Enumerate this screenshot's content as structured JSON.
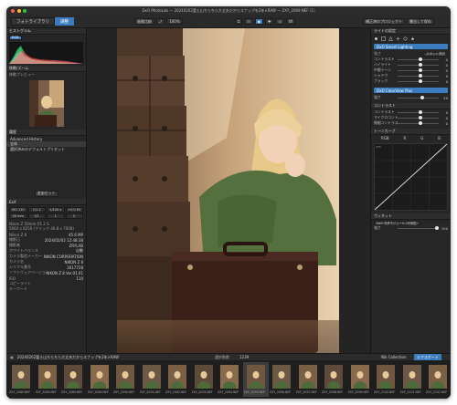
{
  "window": {
    "title": "DxO PhotoLab — 20240202富士山ちらちら大丈夫だからスナップを2年×RAW — ZXY_2089.NEF (1)"
  },
  "toolbar": {
    "tabs": [
      {
        "label": "フォトライブラリ",
        "active": false
      },
      {
        "label": "調整",
        "active": true
      }
    ],
    "compare_label": "画像比較",
    "zoom_label": "100%",
    "export_label": "書出して保存",
    "apply_label": "補正済のプロジェクト"
  },
  "left_panel": {
    "histogram_title": "ヒストグラム",
    "histogram_tab": "RGB",
    "navigator_title": "移動/ズーム",
    "preview_title": "移動プレビュー",
    "history_title": "履歴",
    "history_items": [
      "Advanced History",
      "全体",
      "選択済みのデフォルトプリセット"
    ],
    "history_button": "追加セット",
    "exif_title": "Exif",
    "exif_cells": [
      "ISO 110",
      "1/1.2",
      "1/100 s",
      "+0.0 EV",
      "50 mm",
      "f/1",
      "1",
      "0",
      "",
      ""
    ],
    "meta_camera": "Nikon Z 50mm f/1.2 S",
    "meta_size": "5664 x 8256 (フリック 46.8 x 7008)",
    "meta_rows": [
      {
        "k": "Nikon Z 8",
        "v": "45.6 MP"
      },
      {
        "k": "撮影日",
        "v": "2024/02/02 12:48:38"
      },
      {
        "k": "撮影者",
        "v": "ZRYLAB"
      },
      {
        "k": "ホワイトバランス",
        "v": "自動"
      },
      {
        "k": "カメラ製造メーカー",
        "v": "NIKON CORPORATION"
      },
      {
        "k": "カメラ名",
        "v": "NIKON Z 8"
      },
      {
        "k": "シリアル番号",
        "v": "3017728"
      },
      {
        "k": "ソフトウェアバージョン",
        "v": "NIKON Z 8 Ver.01.01"
      },
      {
        "k": "ISO",
        "v": "110"
      },
      {
        "k": "コピーライト",
        "v": ""
      },
      {
        "k": "キーワード",
        "v": ""
      }
    ]
  },
  "right_panel": {
    "title": "ライトの設定",
    "lighting_button": "DxO Smart Lighting",
    "mode_label": "スポット測光",
    "intensity_label": "強さ",
    "sliders": [
      {
        "label": "コントラスト",
        "value": "0",
        "pos": 0.5
      },
      {
        "label": "ハイライト",
        "value": "0",
        "pos": 0.5
      },
      {
        "label": "中間トーン",
        "value": "0",
        "pos": 0.5
      },
      {
        "label": "シャドウ",
        "value": "0",
        "pos": 0.5
      },
      {
        "label": "ブラック",
        "value": "0",
        "pos": 0.5
      }
    ],
    "clearview_button": "DxO ClearView Plus",
    "clearview_slider": {
      "label": "強さ",
      "value": "50",
      "pos": 0.55
    },
    "contrast_title": "コントラスト",
    "contrast_sliders": [
      {
        "label": "コントラスト",
        "value": "0",
        "pos": 0.5
      },
      {
        "label": "マイクロコントラスト",
        "value": "0",
        "pos": 0.5
      },
      {
        "label": "微細コントラスト",
        "value": "0",
        "pos": 0.5
      }
    ],
    "tonecurve_title": "トーンカーブ",
    "tonecurve_tabs": [
      "RGB",
      "R",
      "G",
      "B"
    ],
    "tonecurve_axis": [
      "255",
      "0"
    ],
    "vignette_title": "ヴィネット",
    "vignette_mode": "DxO 光学モジュール (可用性)",
    "vignette_value": "100"
  },
  "filmstrip": {
    "path": "20240202富士山ちらちら大丈夫だからスナップを2年×RAW",
    "count_label": "選択数数",
    "count_value": "1239",
    "filmstrip_mode": "Nik Collection",
    "export_label": "エクスポート",
    "thumbs": [
      {
        "cap": "ZXY_2089.NEF",
        "sel": false
      },
      {
        "cap": "ZXY_2089.NEF",
        "sel": false
      },
      {
        "cap": "ZXY_2089.NEF",
        "sel": false
      },
      {
        "cap": "ZXY_2089.NEF",
        "sel": false
      },
      {
        "cap": "ZXY_2090.NEF",
        "sel": false
      },
      {
        "cap": "ZXY_2091.NEF",
        "sel": false
      },
      {
        "cap": "ZXY_2092.NEF",
        "sel": false
      },
      {
        "cap": "ZXY_2093.NEF",
        "sel": false
      },
      {
        "cap": "ZXY_2094.NEF",
        "sel": false
      },
      {
        "cap": "ZXY_2095.NEF",
        "sel": true
      },
      {
        "cap": "ZXY_2096.NEF",
        "sel": false
      },
      {
        "cap": "ZXY_2097.NEF",
        "sel": false
      },
      {
        "cap": "ZXY_2098.NEF",
        "sel": false
      },
      {
        "cap": "ZXY_2099.NEF",
        "sel": false
      },
      {
        "cap": "ZXY_2100.NEF",
        "sel": false
      },
      {
        "cap": "ZXY_2101.NEF",
        "sel": false
      },
      {
        "cap": "ZXY_2102.NEF",
        "sel": false
      }
    ]
  },
  "colors": {
    "accent": "#3b7bbf",
    "panel": "#262626",
    "window_bg": "#242424"
  }
}
